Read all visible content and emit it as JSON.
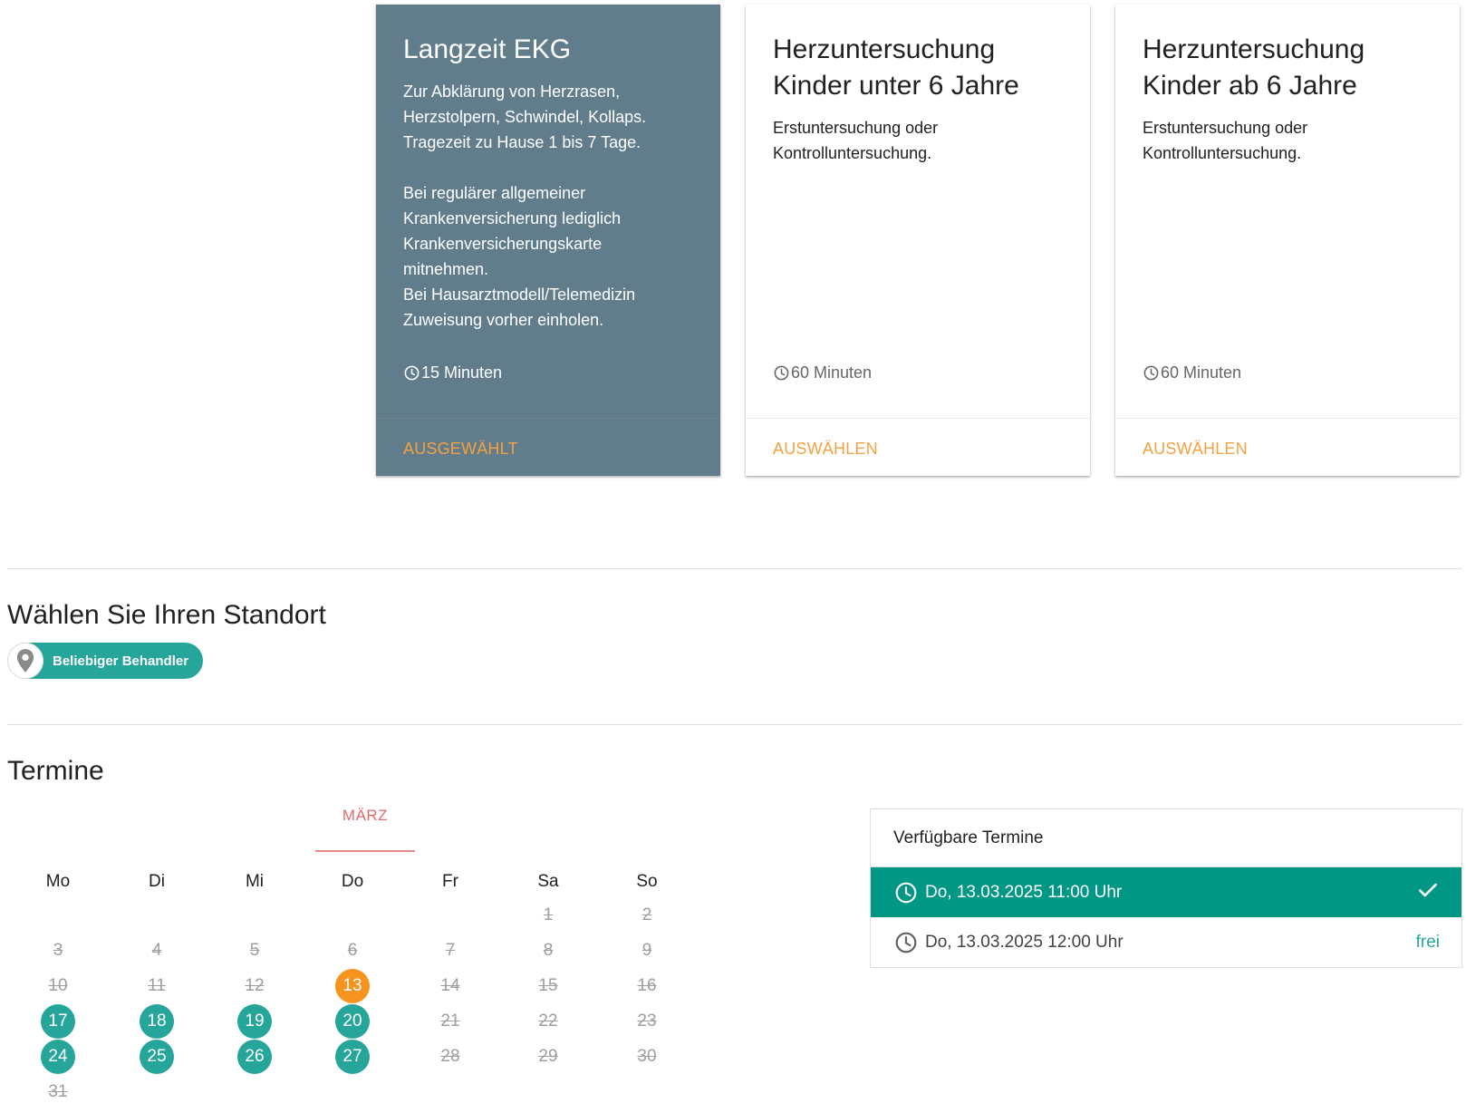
{
  "services": [
    {
      "title_lines": [
        "Langzeit EKG"
      ],
      "description": "Zur Abklärung von Herzrasen,\nHerzstolpern, Schwindel, Kollaps.\nTragezeit zu Hause 1 bis 7 Tage.\n\nBei regulärer allgemeiner\nKrankenversicherung lediglich\nKrankenversicherungskarte\nmitnehmen.\nBei Hausarztmodell/Telemedizin\nZuweisung vorher einholen.",
      "duration": "15 Minuten",
      "action": "Ausgewählt",
      "selected": true
    },
    {
      "title_lines": [
        "Herzuntersuchung",
        "Kinder unter 6 Jahre"
      ],
      "description": "Erstuntersuchung oder\nKontrolluntersuchung.",
      "duration": "60 Minuten",
      "action": "Auswählen",
      "selected": false
    },
    {
      "title_lines": [
        "Herzuntersuchung",
        "Kinder ab 6 Jahre"
      ],
      "description": "Erstuntersuchung oder\nKontrolluntersuchung.",
      "duration": "60 Minuten",
      "action": "Auswählen",
      "selected": false
    }
  ],
  "location": {
    "title": "Wählen Sie Ihren Standort",
    "chip_label": "Beliebiger Behandler",
    "chip_icon": "map-pin-icon"
  },
  "appointments": {
    "title": "Termine",
    "month": "MÄRZ",
    "weekdays": [
      "Mo",
      "Di",
      "Mi",
      "Do",
      "Fr",
      "Sa",
      "So"
    ],
    "start_weekday_index": 5,
    "days_in_month": 31,
    "selected_day": 13,
    "available_days": [
      17,
      18,
      19,
      20,
      24,
      25,
      26,
      27
    ],
    "past_days": [
      1,
      2,
      3,
      4,
      5,
      6,
      7,
      8,
      9,
      10,
      11,
      12,
      14,
      15,
      16,
      21,
      22,
      23,
      28,
      29,
      30,
      31
    ],
    "colors": {
      "available": "#26a69a",
      "selected": "#f7931e",
      "past": "#9e9e9e"
    }
  },
  "slots": {
    "header": "Verfügbare Termine",
    "items": [
      {
        "label": "Do, 13.03.2025 11:00 Uhr",
        "status_icon": "check-icon",
        "status_text": "",
        "active": true
      },
      {
        "label": "Do, 13.03.2025 12:00 Uhr",
        "status_icon": "",
        "status_text": "frei",
        "active": false
      }
    ]
  }
}
